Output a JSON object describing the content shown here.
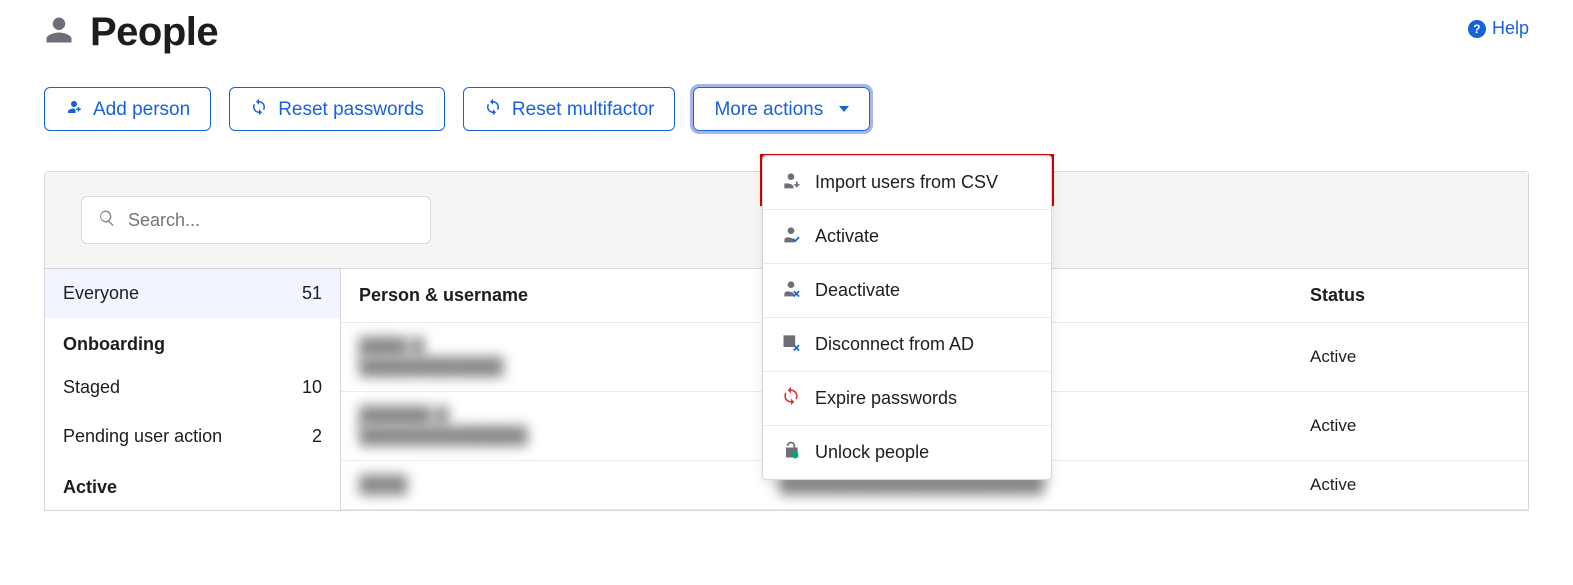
{
  "header": {
    "title": "People",
    "help_label": "Help"
  },
  "toolbar": {
    "add_person": "Add person",
    "reset_passwords": "Reset passwords",
    "reset_multifactor": "Reset multifactor",
    "more_actions": "More actions"
  },
  "search": {
    "placeholder": "Search..."
  },
  "sidebar": {
    "everyone_label": "Everyone",
    "everyone_count": "51",
    "onboarding_header": "Onboarding",
    "staged_label": "Staged",
    "staged_count": "10",
    "pending_label": "Pending user action",
    "pending_count": "2",
    "active_header": "Active"
  },
  "table": {
    "col_person": "Person & username",
    "col_status": "Status"
  },
  "rows": [
    {
      "name": "████ █",
      "email": "████████████",
      "status": "Active"
    },
    {
      "name": "██████ █",
      "email": "██████████████",
      "status": "Active"
    },
    {
      "name": "████",
      "email": "██████████████████████",
      "status": "Active"
    }
  ],
  "dropdown": {
    "import_csv": "Import users from CSV",
    "activate": "Activate",
    "deactivate": "Deactivate",
    "disconnect_ad": "Disconnect from AD",
    "expire_passwords": "Expire passwords",
    "unlock_people": "Unlock people"
  }
}
